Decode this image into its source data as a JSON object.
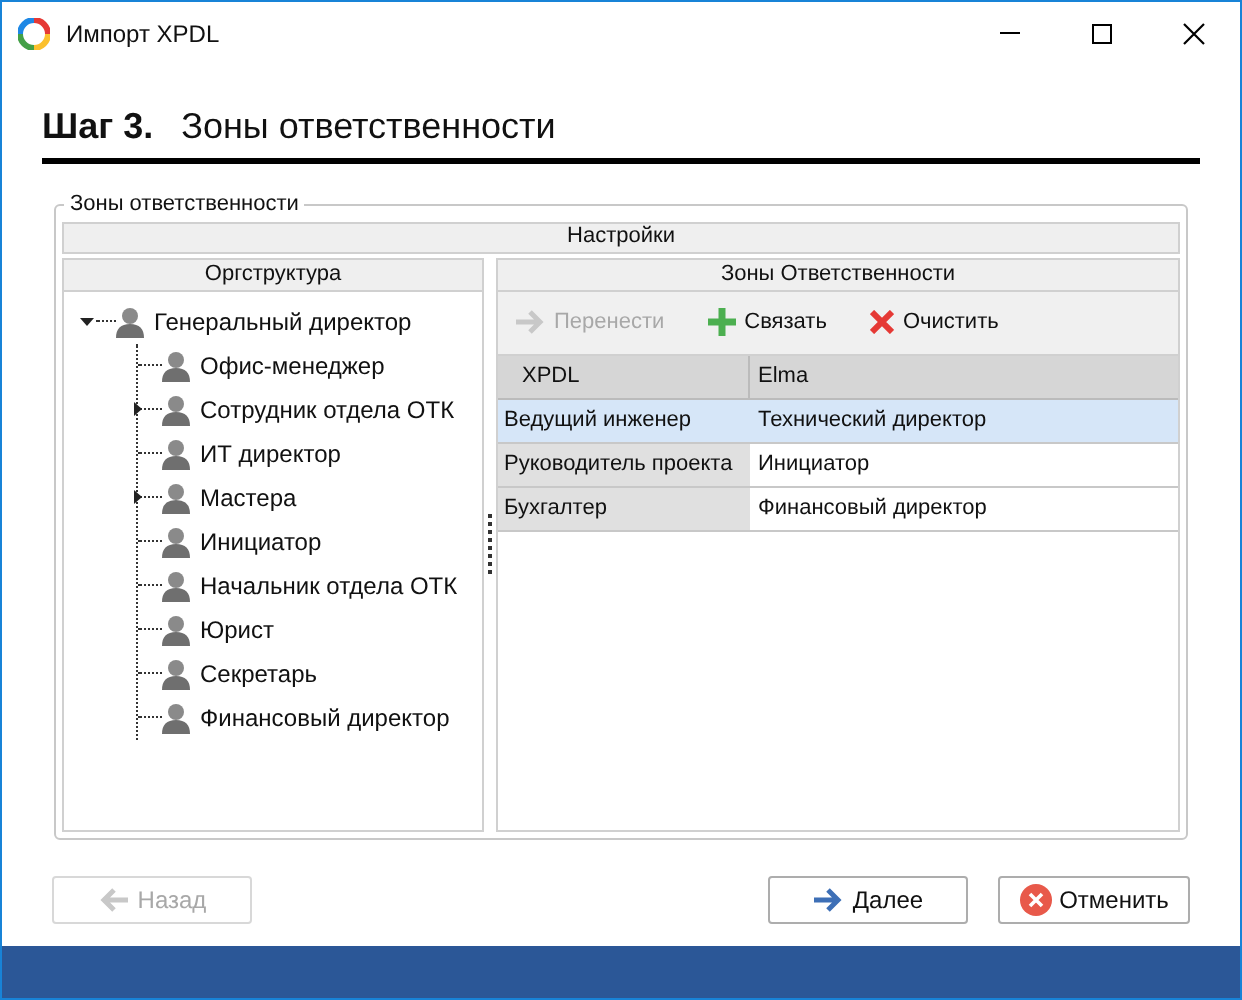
{
  "window": {
    "title": "Импорт XPDL"
  },
  "step": {
    "number": "Шаг 3.",
    "title": "Зоны ответственности"
  },
  "group": {
    "title": "Зоны ответственности",
    "header": "Настройки"
  },
  "org": {
    "header": "Оргструктура",
    "tree": [
      {
        "label": "Генеральный директор",
        "expanded": true,
        "children": [
          {
            "label": "Офис-менеджер",
            "expandable": false
          },
          {
            "label": "Сотрудник отдела ОТК",
            "expandable": true
          },
          {
            "label": "ИТ директор",
            "expandable": false
          },
          {
            "label": "Мастера",
            "expandable": true
          },
          {
            "label": "Инициатор",
            "expandable": false
          },
          {
            "label": "Начальник отдела ОТК",
            "expandable": false
          },
          {
            "label": "Юрист",
            "expandable": false
          },
          {
            "label": "Секретарь",
            "expandable": false
          },
          {
            "label": "Финансовый директор",
            "expandable": false
          }
        ]
      }
    ]
  },
  "zones": {
    "header": "Зоны Ответственности",
    "toolbar": [
      {
        "kind": "move",
        "label": "Перенести",
        "disabled": true
      },
      {
        "kind": "link",
        "label": "Связать",
        "disabled": false
      },
      {
        "kind": "clear",
        "label": "Очистить",
        "disabled": false
      }
    ],
    "columns": [
      "XPDL",
      "Elma"
    ],
    "rows": [
      {
        "xpdl": "Ведущий инженер",
        "elma": "Технический директор",
        "selected": true
      },
      {
        "xpdl": "Руководитель проекта",
        "elma": "Инициатор",
        "selected": false
      },
      {
        "xpdl": "Бухгалтер",
        "elma": "Финансовый директор",
        "selected": false
      }
    ]
  },
  "buttons": [
    {
      "kind": "back",
      "label": "Назад",
      "disabled": true
    },
    {
      "kind": "next",
      "label": "Далее",
      "disabled": false
    },
    {
      "kind": "cancel",
      "label": "Отменить",
      "disabled": false
    }
  ]
}
